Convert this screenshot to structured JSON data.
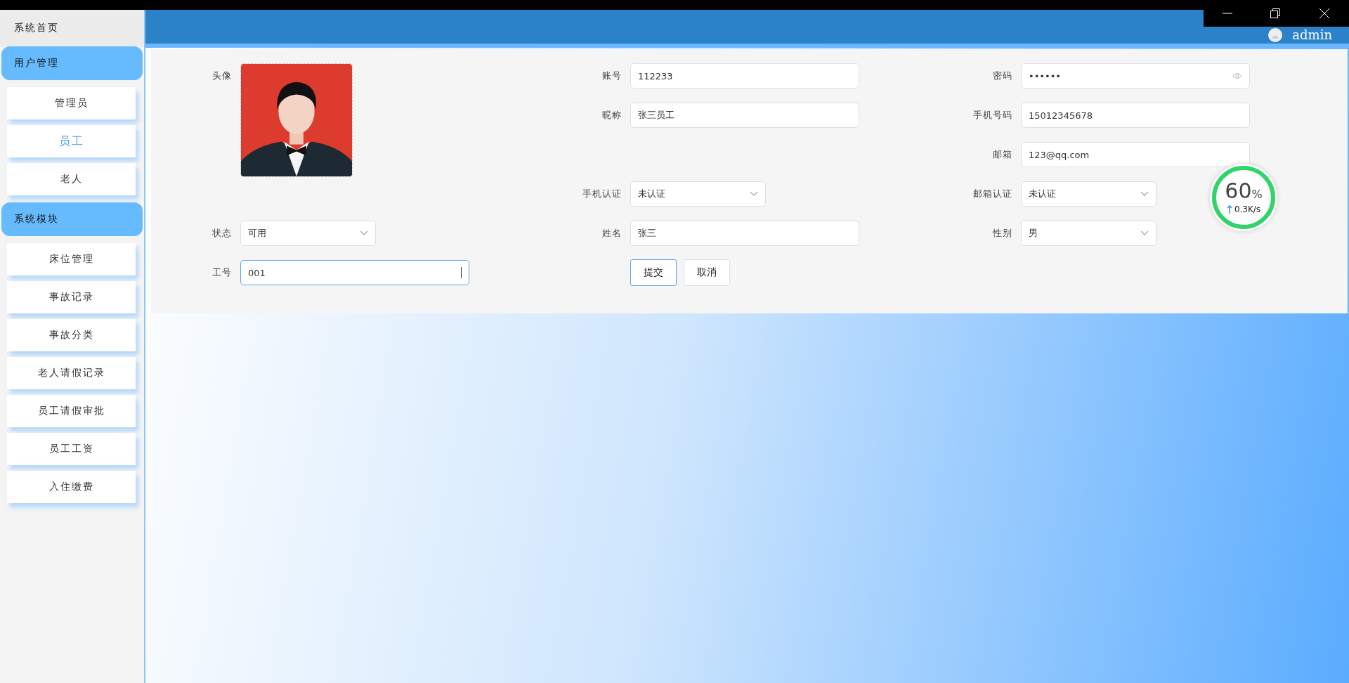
{
  "sidebar": {
    "home": "系统首页",
    "groups": [
      {
        "title": "用户管理",
        "items": [
          {
            "label": "管理员",
            "selected": false
          },
          {
            "label": "员工",
            "selected": true
          },
          {
            "label": "老人",
            "selected": false
          }
        ]
      },
      {
        "title": "系统模块",
        "items": [
          {
            "label": "床位管理",
            "selected": false
          },
          {
            "label": "事故记录",
            "selected": false
          },
          {
            "label": "事故分类",
            "selected": false
          },
          {
            "label": "老人请假记录",
            "selected": false
          },
          {
            "label": "员工请假审批",
            "selected": false
          },
          {
            "label": "员工工资",
            "selected": false
          },
          {
            "label": "入住缴费",
            "selected": false
          }
        ]
      }
    ]
  },
  "header": {
    "user": "admin"
  },
  "form": {
    "fields": [
      {
        "kind": "avatar",
        "label": "头像"
      },
      {
        "kind": "input",
        "label": "账号",
        "value": "112233",
        "focused": false
      },
      {
        "kind": "password",
        "label": "密码",
        "value": "••••••",
        "focused": false
      },
      {
        "kind": "input",
        "label": "昵称",
        "value": "张三员工",
        "focused": false
      },
      {
        "kind": "input",
        "label": "手机号码",
        "value": "15012345678",
        "focused": false
      },
      {
        "kind": "input",
        "label": "邮箱",
        "value": "123@qq.com",
        "focused": false
      },
      {
        "kind": "select",
        "label": "手机认证",
        "value": "未认证"
      },
      {
        "kind": "select",
        "label": "邮箱认证",
        "value": "未认证"
      },
      {
        "kind": "select",
        "label": "状态",
        "value": "可用"
      },
      {
        "kind": "input",
        "label": "姓名",
        "value": "张三",
        "focused": false
      },
      {
        "kind": "select",
        "label": "性别",
        "value": "男"
      },
      {
        "kind": "input",
        "label": "工号",
        "value": "001",
        "focused": true
      }
    ],
    "buttons": [
      {
        "label": "提交",
        "focused": true
      },
      {
        "label": "取消",
        "focused": false
      }
    ]
  },
  "speed_widget": {
    "percent": "60",
    "unit": "%",
    "rate": "0.3K/s"
  }
}
